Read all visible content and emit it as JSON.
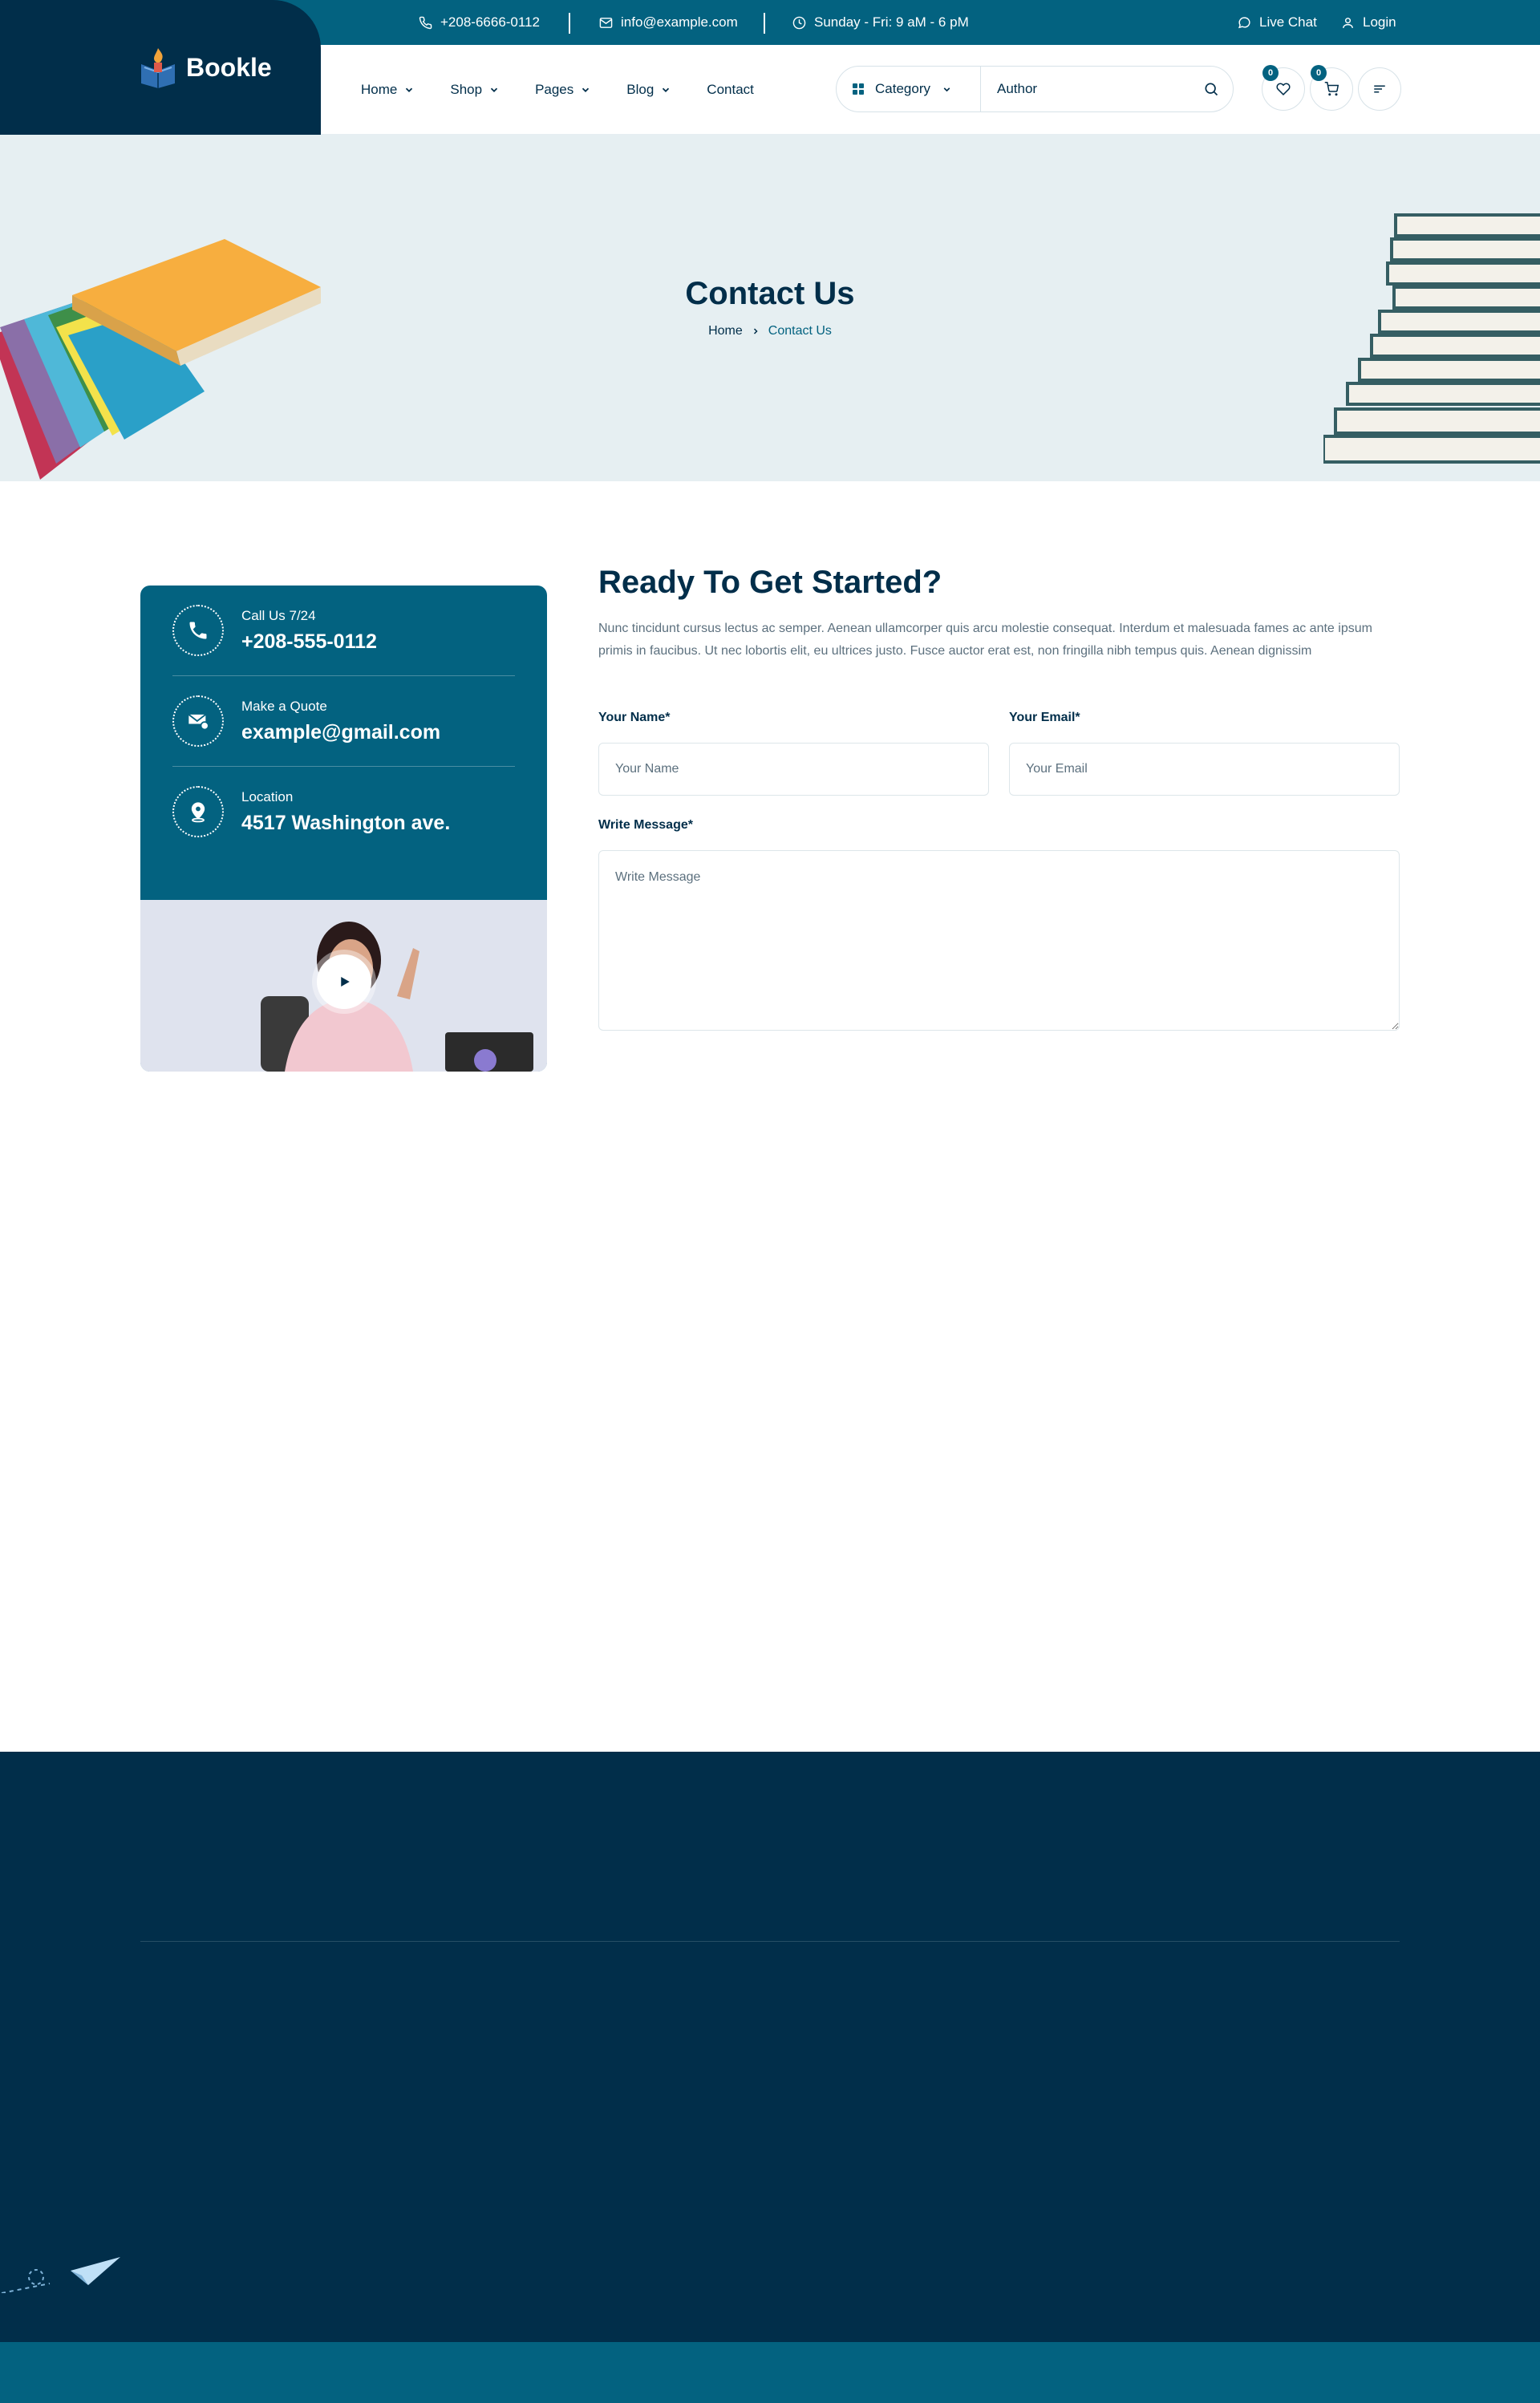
{
  "topbar": {
    "phone": "+208-6666-0112",
    "email": "info@example.com",
    "hours": "Sunday - Fri: 9 aM - 6 pM",
    "live_chat": "Live Chat",
    "login": "Login"
  },
  "brand": {
    "name": "Bookle"
  },
  "nav": {
    "items": [
      {
        "label": "Home"
      },
      {
        "label": "Shop"
      },
      {
        "label": "Pages"
      },
      {
        "label": "Blog"
      },
      {
        "label": "Contact"
      }
    ]
  },
  "search": {
    "category_label": "Category",
    "author_placeholder": "Author"
  },
  "counters": {
    "wishlist": "0",
    "cart": "0"
  },
  "hero": {
    "title": "Contact Us",
    "breadcrumb_home": "Home",
    "breadcrumb_current": "Contact Us"
  },
  "contact_info": {
    "items": [
      {
        "label": "Call Us 7/24",
        "value": "+208-555-0112",
        "icon": "phone-icon"
      },
      {
        "label": "Make a Quote",
        "value": "example@gmail.com",
        "icon": "mail-icon"
      },
      {
        "label": "Location",
        "value": "4517 Washington ave.",
        "icon": "location-pin-icon"
      }
    ]
  },
  "form": {
    "title": "Ready To Get Started?",
    "description": "Nunc tincidunt cursus lectus ac semper. Aenean ullamcorper quis arcu molestie consequat. Interdum et malesuada fames ac ante ipsum primis in faucibus. Ut nec lobortis elit, eu ultrices justo. Fusce auctor erat est, non fringilla nibh tempus quis. Aenean dignissim",
    "name_label": "Your Name*",
    "name_placeholder": "Your Name",
    "email_label": "Your Email*",
    "email_placeholder": "Your Email",
    "message_label": "Write Message*",
    "message_placeholder": "Write Message"
  },
  "colors": {
    "primary": "#036280",
    "dark": "#012e4a",
    "hero_bg": "#e6eff2",
    "text_muted": "#5c707e"
  }
}
